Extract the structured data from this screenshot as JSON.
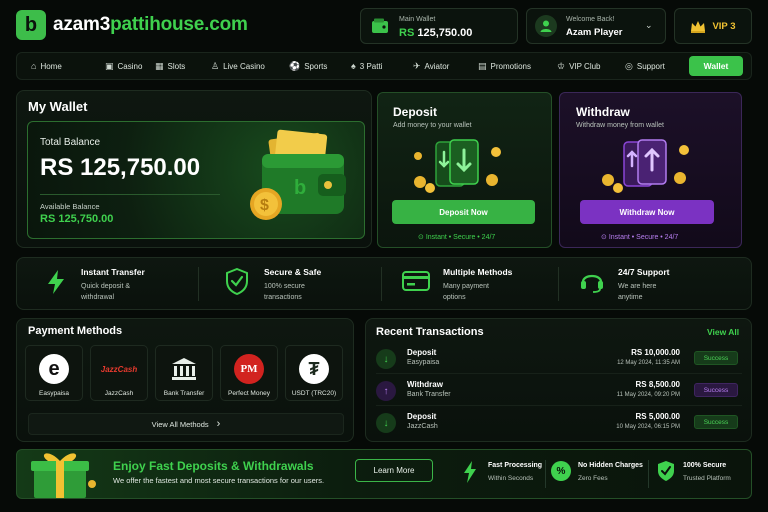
{
  "header": {
    "logo_letter": "b",
    "brand_prefix": "azam3",
    "brand_name": "pattihouse.com",
    "main_wallet_label": "Main Wallet",
    "main_wallet_value": "RS 125,750.00",
    "welcome_label": "Welcome Back!",
    "user_name": "Azam Player",
    "vip_label": "VIP 3"
  },
  "nav": {
    "items": [
      {
        "label": "Home",
        "icon": "home-icon"
      },
      {
        "label": "Casino",
        "icon": "casino-icon"
      },
      {
        "label": "Slots",
        "icon": "slots-icon"
      },
      {
        "label": "Live Casino",
        "icon": "live-casino-icon"
      },
      {
        "label": "Sports",
        "icon": "sports-icon"
      },
      {
        "label": "3 Patti",
        "icon": "cards-icon"
      },
      {
        "label": "Aviator",
        "icon": "aviator-icon"
      },
      {
        "label": "Promotions",
        "icon": "promotions-icon"
      },
      {
        "label": "VIP Club",
        "icon": "vip-icon"
      },
      {
        "label": "Support",
        "icon": "support-icon"
      }
    ],
    "wallet_button": "Wallet"
  },
  "wallet": {
    "title": "My Wallet",
    "total_balance_label": "Total Balance",
    "total_balance_value": "RS 125,750.00",
    "available_label": "Available Balance",
    "available_value": "RS 125,750.00"
  },
  "deposit": {
    "title": "Deposit",
    "subtitle": "Add money to your wallet",
    "button": "Deposit Now",
    "note": "Instant • Secure • 24/7"
  },
  "withdraw": {
    "title": "Withdraw",
    "subtitle": "Withdraw money from wallet",
    "button": "Withdraw Now",
    "note": "Instant • Secure • 24/7"
  },
  "features": [
    {
      "title": "Instant Transfer",
      "line1": "Quick deposit &",
      "line2": "withdrawal",
      "icon": "lightning-icon"
    },
    {
      "title": "Secure & Safe",
      "line1": "100% secure",
      "line2": "transactions",
      "icon": "shield-check-icon"
    },
    {
      "title": "Multiple Methods",
      "line1": "Many payment",
      "line2": "options",
      "icon": "card-icon"
    },
    {
      "title": "24/7 Support",
      "line1": "We are here",
      "line2": "anytime",
      "icon": "headset-icon"
    }
  ],
  "payment_methods": {
    "title": "Payment Methods",
    "items": [
      {
        "label": "Easypaisa",
        "glyph": "e"
      },
      {
        "label": "JazzCash",
        "glyph": "JazzCash"
      },
      {
        "label": "Bank Transfer",
        "glyph": "🏛"
      },
      {
        "label": "Perfect Money",
        "glyph": "PM"
      },
      {
        "label": "USDT (TRC20)",
        "glyph": "₮"
      }
    ],
    "view_all": "View All Methods"
  },
  "transactions": {
    "title": "Recent Transactions",
    "view_all": "View All",
    "rows": [
      {
        "type": "Deposit",
        "method": "Easypaisa",
        "amount": "RS 10,000.00",
        "date": "12 May 2024, 11:35 AM",
        "status": "Success",
        "direction": "in"
      },
      {
        "type": "Withdraw",
        "method": "Bank Transfer",
        "amount": "RS 8,500.00",
        "date": "11 May 2024, 09:20 PM",
        "status": "Success",
        "direction": "out"
      },
      {
        "type": "Deposit",
        "method": "JazzCash",
        "amount": "RS 5,000.00",
        "date": "10 May 2024, 06:15 PM",
        "status": "Success",
        "direction": "in"
      }
    ]
  },
  "promo": {
    "title": "Enjoy Fast Deposits & Withdrawals",
    "subtitle": "We offer the fastest and most secure transactions for our users.",
    "button": "Learn More",
    "features": [
      {
        "title": "Fast Processing",
        "sub": "Within Seconds"
      },
      {
        "title": "No Hidden Charges",
        "sub": "Zero Fees"
      },
      {
        "title": "100% Secure",
        "sub": "Trusted Platform"
      }
    ]
  },
  "colors": {
    "accent_green": "#3fd14e",
    "purple": "#7b32c2",
    "gold": "#f1c232",
    "background": "#060a07"
  }
}
